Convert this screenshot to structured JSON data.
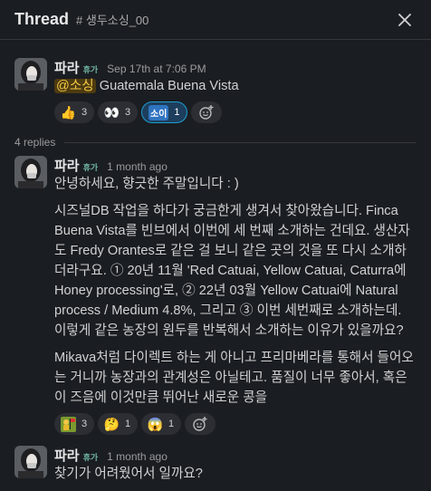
{
  "header": {
    "title": "Thread",
    "channel": "# 생두소싱_00"
  },
  "messages": [
    {
      "name": "파라",
      "badge": "휴가",
      "time": "Sep 17th at 7:06 PM",
      "mention": "@소싱",
      "text": " Guatemala Buena Vista",
      "reactions": [
        {
          "emoji": "thumbs-up",
          "count": "3"
        },
        {
          "emoji": "eyes",
          "count": "3"
        },
        {
          "emoji": "소이",
          "count": "1"
        }
      ]
    },
    {
      "name": "파라",
      "badge": "휴가",
      "time": "1 month ago",
      "paragraphs": [
        "안녕하세요, 향긋한 주말입니다 : )",
        "시즈널DB 작업을 하다가 궁금한게 생겨서 찾아왔습니다. Finca Buena Vista를 빈브에서 이번에 세 번째 소개하는 건데요. 생산자도 Fredy Orantes로 같은 걸 보니 같은 곳의 것을 또 다시 소개하더라구요. ① 20년 11월 'Red Catuai, Yellow Catuai, Caturra에 Honey processing'로, ② 22년 03월 Yellow Catuai에 Natural process / Medium 4.8%, 그리고 ③ 이번 세번째로 소개하는데. 이렇게 같은 농장의 원두를 반복해서 소개하는 이유가 있을까요?",
        "Mikava처럼 다이렉트 하는 게 아니고 프리마베라를 통해서 들어오는 거니까 농장과의 관계성은 아닐테고. 품질이 너무 좋아서, 혹은 이 즈음에 이것만큼 뛰어난 새로운 콩을"
      ],
      "reactions": [
        {
          "emoji": "person-with-flag",
          "count": "3"
        },
        {
          "emoji": "thinking-face",
          "count": "1"
        },
        {
          "emoji": "screaming-face",
          "count": "1"
        }
      ]
    },
    {
      "name": "파라",
      "badge": "휴가",
      "time": "1 month ago",
      "text": "찾기가 어려웠어서 일까요?"
    }
  ],
  "replies_label": "4 replies"
}
